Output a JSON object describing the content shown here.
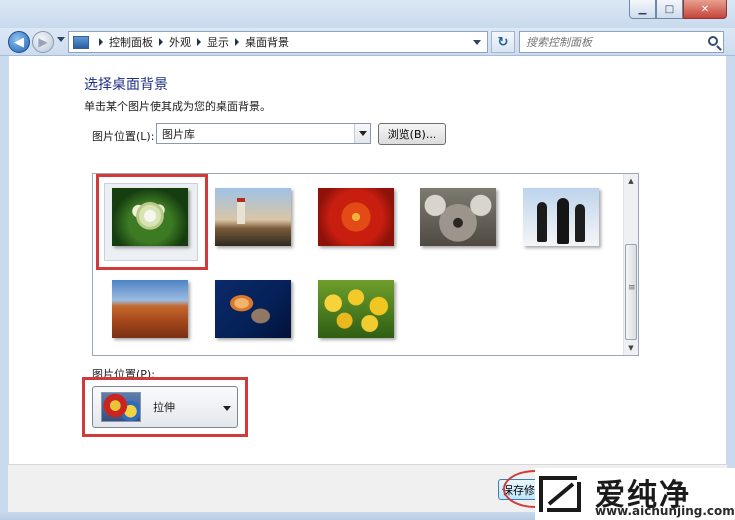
{
  "window": {
    "minimize": "▁",
    "maximize": "□",
    "close": "✕"
  },
  "navbar": {
    "breadcrumbs": [
      "控制面板",
      "外观",
      "显示",
      "桌面背景"
    ],
    "search_placeholder": "搜索控制面板"
  },
  "main": {
    "title": "选择桌面背景",
    "subtitle": "单击某个图片使其成为您的桌面背景。",
    "picture_location_label": "图片位置(L):",
    "picture_location_value": "图片库",
    "browse_label": "浏览(B)...",
    "thumbnails": [
      {
        "name": "hydrangea",
        "selected": true
      },
      {
        "name": "lighthouse"
      },
      {
        "name": "chrysanthemum"
      },
      {
        "name": "koala"
      },
      {
        "name": "penguins"
      },
      {
        "name": "desert"
      },
      {
        "name": "jellyfish"
      },
      {
        "name": "tulips"
      }
    ],
    "picture_position_label": "图片位置(P):",
    "picture_position_value": "拉伸"
  },
  "footer": {
    "save_label": "保存修改"
  },
  "watermark": {
    "name": "爱纯净",
    "url": "www.aichunjing.com"
  },
  "colors": {
    "highlight": "#d03a3a",
    "title_blue": "#1e3287"
  }
}
